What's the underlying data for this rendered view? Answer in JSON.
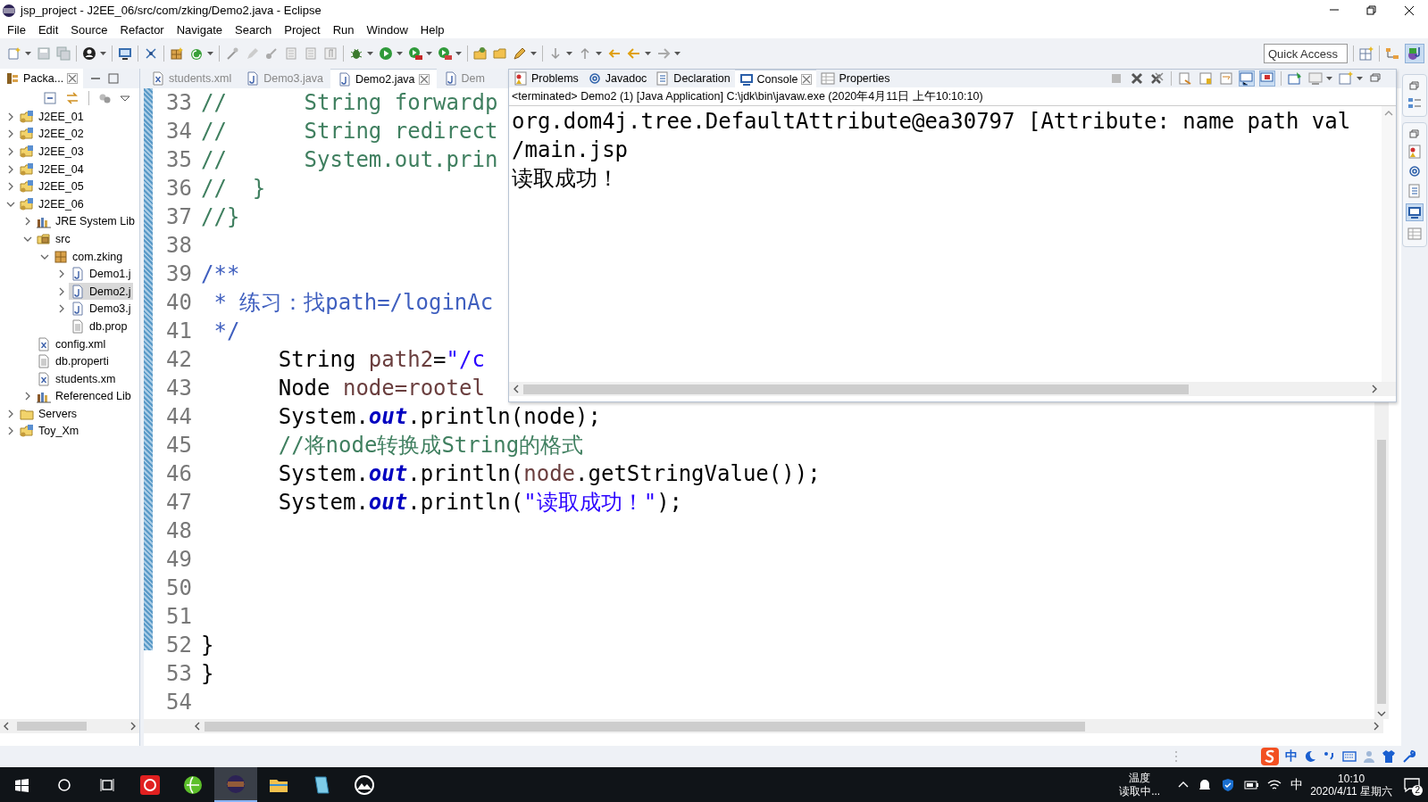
{
  "window": {
    "title": "jsp_project - J2EE_06/src/com/zking/Demo2.java - Eclipse"
  },
  "menu": [
    "File",
    "Edit",
    "Source",
    "Refactor",
    "Navigate",
    "Search",
    "Project",
    "Run",
    "Window",
    "Help"
  ],
  "quick_access": {
    "placeholder": "Quick Access"
  },
  "explorer": {
    "tab": {
      "label": "Packa...",
      "selected": true
    },
    "tree": [
      {
        "label": "J2EE_01",
        "kind": "project",
        "expanded": false,
        "selected": false
      },
      {
        "label": "J2EE_02",
        "kind": "project",
        "expanded": false,
        "selected": false
      },
      {
        "label": "J2EE_03",
        "kind": "project",
        "expanded": false,
        "selected": false
      },
      {
        "label": "J2EE_04",
        "kind": "project",
        "expanded": false,
        "selected": false
      },
      {
        "label": "J2EE_05",
        "kind": "project",
        "expanded": false,
        "selected": false
      },
      {
        "label": "J2EE_06",
        "kind": "project",
        "expanded": true,
        "selected": false,
        "children": [
          {
            "label": "JRE System Lib",
            "kind": "library",
            "expanded": false,
            "selected": false
          },
          {
            "label": "src",
            "kind": "source",
            "expanded": true,
            "selected": false,
            "children": [
              {
                "label": "com.zking",
                "kind": "package",
                "expanded": true,
                "selected": false,
                "children": [
                  {
                    "label": "Demo1.j",
                    "kind": "java",
                    "expanded": false,
                    "selected": false
                  },
                  {
                    "label": "Demo2.j",
                    "kind": "java",
                    "expanded": false,
                    "selected": true
                  },
                  {
                    "label": "Demo3.j",
                    "kind": "java",
                    "expanded": false,
                    "selected": false
                  },
                  {
                    "label": "db.prop",
                    "kind": "file",
                    "selected": false
                  }
                ]
              }
            ]
          },
          {
            "label": "config.xml",
            "kind": "xml",
            "selected": false
          },
          {
            "label": "db.properti",
            "kind": "file",
            "selected": false
          },
          {
            "label": "students.xm",
            "kind": "xml",
            "selected": false
          },
          {
            "label": "Referenced Lib",
            "kind": "library",
            "expanded": false,
            "selected": false
          }
        ]
      },
      {
        "label": "Servers",
        "kind": "folder",
        "expanded": false,
        "selected": false
      },
      {
        "label": "Toy_Xm",
        "kind": "project",
        "expanded": false,
        "selected": false
      }
    ]
  },
  "editor": {
    "tabs": [
      {
        "label": "students.xml",
        "kind": "xml",
        "selected": false
      },
      {
        "label": "Demo3.java",
        "kind": "java",
        "selected": false
      },
      {
        "label": "Demo2.java",
        "kind": "java",
        "selected": true
      },
      {
        "label": "Dem",
        "kind": "java",
        "selected": false
      }
    ],
    "lines": [
      {
        "number": "33",
        "tokens": [
          {
            "kind": "comment",
            "text": "//      String forwardp"
          }
        ]
      },
      {
        "number": "34",
        "tokens": [
          {
            "kind": "comment",
            "text": "//      String redirect"
          }
        ]
      },
      {
        "number": "35",
        "tokens": [
          {
            "kind": "comment",
            "text": "//      System.out.prin"
          }
        ]
      },
      {
        "number": "36",
        "tokens": [
          {
            "kind": "comment",
            "text": "//  }"
          }
        ]
      },
      {
        "number": "37",
        "tokens": [
          {
            "kind": "comment",
            "text": "//}"
          }
        ]
      },
      {
        "number": "38"
      },
      {
        "number": "39",
        "tokens": [
          {
            "kind": "javadoc",
            "text": "/**"
          }
        ]
      },
      {
        "number": "40",
        "tokens": [
          {
            "kind": "javadoc",
            "text": " * 练习：找path=/loginAc"
          }
        ]
      },
      {
        "number": "41",
        "tokens": [
          {
            "kind": "javadoc",
            "text": " */"
          }
        ]
      },
      {
        "number": "42",
        "tokens": [
          {
            "kind": "plain",
            "text": "      String "
          },
          {
            "kind": "local",
            "text": "path2"
          },
          {
            "kind": "plain",
            "text": "="
          },
          {
            "kind": "string",
            "text": "\"/c"
          }
        ]
      },
      {
        "number": "43",
        "tokens": [
          {
            "kind": "plain",
            "text": "      Node "
          },
          {
            "kind": "local",
            "text": "node=rootel"
          }
        ]
      },
      {
        "number": "44",
        "tokens": [
          {
            "kind": "plain",
            "text": "      System."
          },
          {
            "kind": "field",
            "text": "out"
          },
          {
            "kind": "plain",
            "text": ".println(node);"
          }
        ]
      },
      {
        "number": "45",
        "tokens": [
          {
            "kind": "comment",
            "text": "      //将node转换成String的格式"
          }
        ]
      },
      {
        "number": "46",
        "tokens": [
          {
            "kind": "plain",
            "text": "      System."
          },
          {
            "kind": "field",
            "text": "out"
          },
          {
            "kind": "plain",
            "text": ".println("
          },
          {
            "kind": "local",
            "text": "node"
          },
          {
            "kind": "plain",
            "text": ".getStringValue());"
          }
        ]
      },
      {
        "number": "47",
        "tokens": [
          {
            "kind": "plain",
            "text": "      System."
          },
          {
            "kind": "field",
            "text": "out"
          },
          {
            "kind": "plain",
            "text": ".println("
          },
          {
            "kind": "string",
            "text": "\"读取成功！\""
          },
          {
            "kind": "plain",
            "text": ");"
          }
        ]
      },
      {
        "number": "48"
      },
      {
        "number": "49"
      },
      {
        "number": "50"
      },
      {
        "number": "51"
      },
      {
        "number": "52",
        "tokens": [
          {
            "kind": "plain",
            "text": "}"
          }
        ]
      },
      {
        "number": "53",
        "tokens": [
          {
            "kind": "plain",
            "text": "}"
          }
        ]
      },
      {
        "number": "54"
      }
    ]
  },
  "console": {
    "tabs": [
      {
        "label": "Problems",
        "kind": "problems",
        "selected": false
      },
      {
        "label": "Javadoc",
        "kind": "javadoc",
        "selected": false
      },
      {
        "label": "Declaration",
        "kind": "declaration",
        "selected": false
      },
      {
        "label": "Console",
        "kind": "console",
        "selected": true
      },
      {
        "label": "Properties",
        "kind": "properties",
        "selected": false
      }
    ],
    "status": "<terminated> Demo2 (1) [Java Application] C:\\jdk\\bin\\javaw.exe (2020年4月11日 上午10:10:10)",
    "output": [
      "org.dom4j.tree.DefaultAttribute@ea30797 [Attribute: name path val",
      "/main.jsp",
      "读取成功！"
    ]
  },
  "status_bar": {
    "ime": "中"
  },
  "taskbar": {
    "apps": [
      {
        "kind": "music",
        "selected": false
      },
      {
        "kind": "globe",
        "selected": false
      },
      {
        "kind": "ide",
        "selected": true
      },
      {
        "kind": "folder",
        "selected": false
      },
      {
        "kind": "notebook",
        "selected": false
      },
      {
        "kind": "mountain",
        "selected": false
      }
    ],
    "weather_label": "温度",
    "weather_status": "读取中...",
    "ime": "中",
    "time": "10:10",
    "date": "2020/4/11 星期六",
    "notifications": "2"
  }
}
